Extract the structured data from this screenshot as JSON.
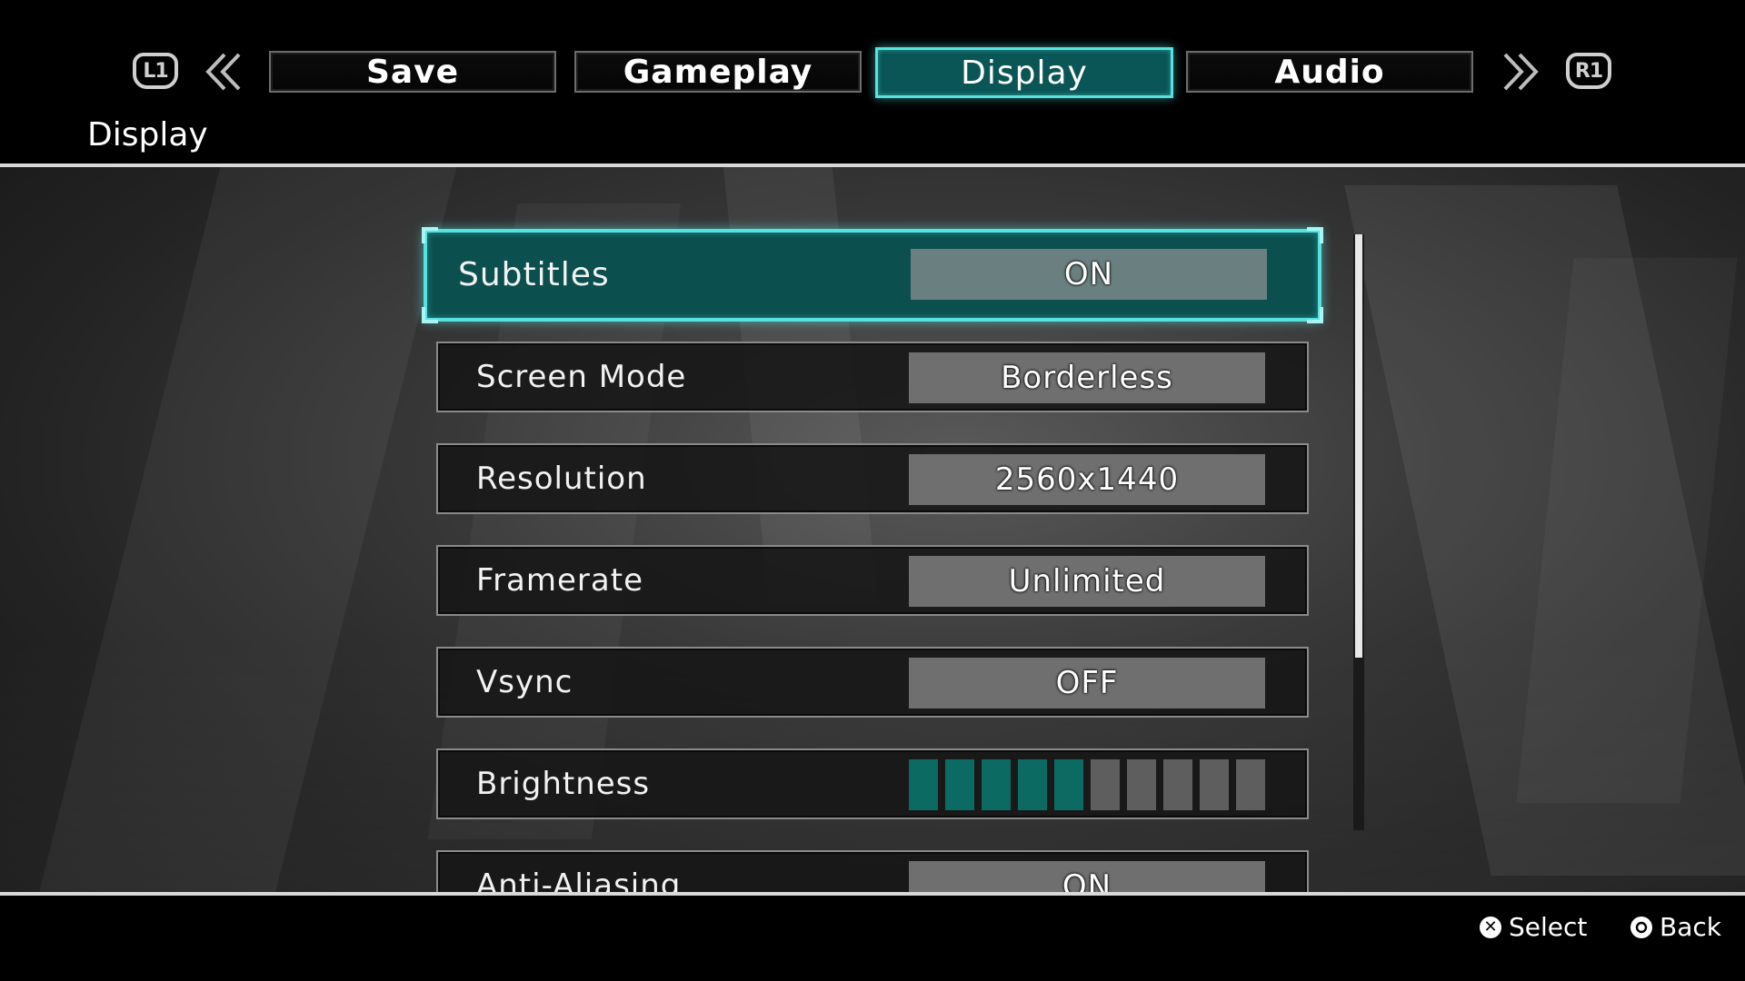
{
  "header": {
    "left_shoulder": "L1",
    "right_shoulder": "R1",
    "tabs": [
      {
        "label": "Save",
        "active": false
      },
      {
        "label": "Gameplay",
        "active": false
      },
      {
        "label": "Display",
        "active": true
      },
      {
        "label": "Audio",
        "active": false
      }
    ],
    "section_title": "Display"
  },
  "settings": [
    {
      "label": "Subtitles",
      "value": "ON",
      "selected": true
    },
    {
      "label": "Screen Mode",
      "value": "Borderless"
    },
    {
      "label": "Resolution",
      "value": "2560x1440"
    },
    {
      "label": "Framerate",
      "value": "Unlimited"
    },
    {
      "label": "Vsync",
      "value": "OFF"
    },
    {
      "label": "Brightness",
      "level": 5,
      "max": 10
    },
    {
      "label": "Anti-Aliasing",
      "value": "ON"
    }
  ],
  "scrollbar": {
    "visible_fraction": 0.71
  },
  "footer": {
    "select": {
      "icon": "cross-button-icon",
      "label": "Select"
    },
    "back": {
      "icon": "circle-button-icon",
      "label": "Back"
    }
  },
  "colors": {
    "accent": "#56e3e0",
    "accent_dark": "#0b4f4f",
    "bar_on": "#0b6b63"
  }
}
